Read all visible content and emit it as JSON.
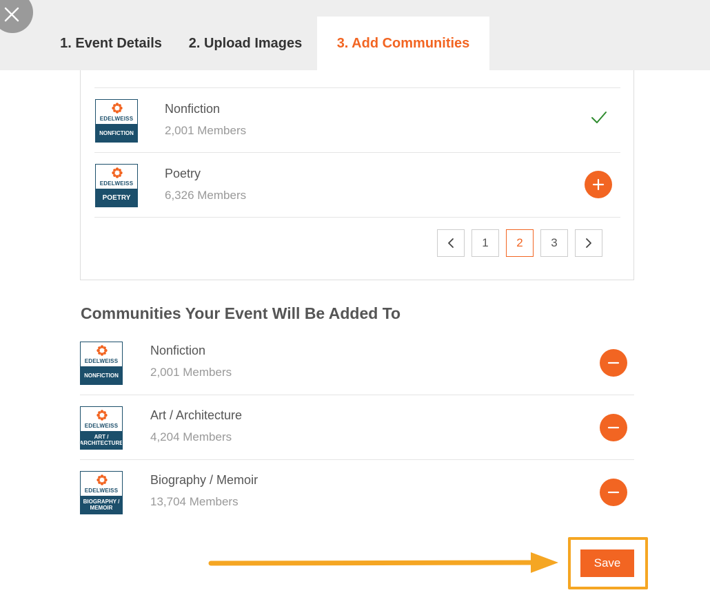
{
  "tabs": [
    {
      "label": "1. Event Details",
      "active": false
    },
    {
      "label": "2. Upload Images",
      "active": false
    },
    {
      "label": "3. Add Communities",
      "active": true
    }
  ],
  "brand_name": "EDELWEISS",
  "picker": {
    "items": [
      {
        "name": "Nonfiction",
        "members": "2,001 Members",
        "badge": "NONFICTION",
        "state": "added",
        "icon": "check-icon"
      },
      {
        "name": "Poetry",
        "members": "6,326 Members",
        "badge": "POETRY",
        "state": "available",
        "icon": "plus-icon"
      }
    ],
    "pagination": {
      "prev_icon": "chevron-left-icon",
      "next_icon": "chevron-right-icon",
      "pages": [
        "1",
        "2",
        "3"
      ],
      "current": "2"
    }
  },
  "added": {
    "title": "Communities Your Event Will Be Added To",
    "items": [
      {
        "name": "Nonfiction",
        "members": "2,001 Members",
        "badge": "NONFICTION",
        "icon": "minus-icon"
      },
      {
        "name": "Art / Architecture",
        "members": "4,204 Members",
        "badge": "ART / ARCHITECTURE",
        "icon": "minus-icon"
      },
      {
        "name": "Biography / Memoir",
        "members": "13,704 Members",
        "badge": "BIOGRAPHY / MEMOIR",
        "icon": "minus-icon"
      }
    ]
  },
  "save_label": "Save",
  "colors": {
    "accent": "#f26522",
    "brand_blue": "#1c4f6b",
    "highlight": "#f5a623",
    "check": "#2e8b2e"
  }
}
